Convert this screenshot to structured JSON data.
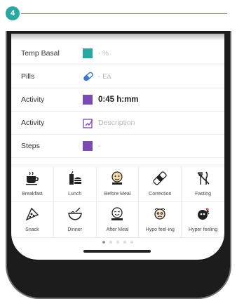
{
  "step": {
    "number": "4",
    "accent": "#2aa7a0"
  },
  "log_rows": [
    {
      "label": "Temp Basal",
      "icon": "teal-square-icon",
      "value": "- %"
    },
    {
      "label": "Pills",
      "icon": "pill-icon",
      "value": "-  Ea"
    },
    {
      "label": "Activity",
      "icon": "purple-square-icon",
      "value": "0:45 h:mm"
    },
    {
      "label": "Activity",
      "icon": "edit-note-icon",
      "value": "Description"
    },
    {
      "label": "Steps",
      "icon": "purple-square-icon",
      "value": "-"
    }
  ],
  "quick_tags": [
    {
      "label": "Breakfast",
      "icon": "coffee-cup-icon"
    },
    {
      "label": "Lunch",
      "icon": "burger-drink-icon"
    },
    {
      "label": "Before Meal",
      "icon": "face-before-meal-icon"
    },
    {
      "label": "Correction",
      "icon": "bandage-icon"
    },
    {
      "label": "Fasting",
      "icon": "no-fork-knife-icon"
    },
    {
      "label": "Snack",
      "icon": "pizza-slice-icon"
    },
    {
      "label": "Dinner",
      "icon": "dinner-bowl-icon"
    },
    {
      "label": "After Meal",
      "icon": "face-after-meal-icon"
    },
    {
      "label": "Hypo feel-ing",
      "icon": "face-hypo-icon"
    },
    {
      "label": "Hyper feeling",
      "icon": "face-hyper-icon"
    }
  ],
  "pager": {
    "total": 5,
    "active": 1
  },
  "colors": {
    "teal": "#2aa7a0",
    "purple": "#7a4bb0"
  }
}
